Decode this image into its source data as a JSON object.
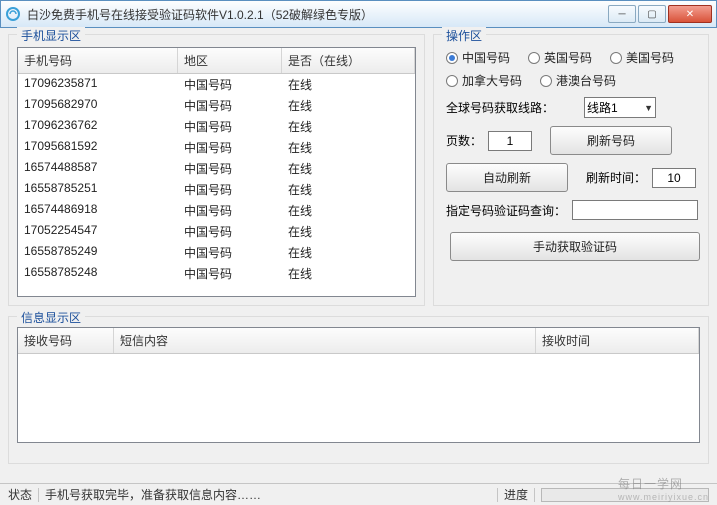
{
  "window": {
    "title": "白沙免费手机号在线接受验证码软件V1.0.2.1（52破解绿色专版）"
  },
  "phone_area": {
    "legend": "手机显示区",
    "columns": {
      "phone": "手机号码",
      "region": "地区",
      "online": "是否（在线）"
    },
    "rows": [
      {
        "phone": "17096235871",
        "region": "中国号码",
        "online": "在线"
      },
      {
        "phone": "17095682970",
        "region": "中国号码",
        "online": "在线"
      },
      {
        "phone": "17096236762",
        "region": "中国号码",
        "online": "在线"
      },
      {
        "phone": "17095681592",
        "region": "中国号码",
        "online": "在线"
      },
      {
        "phone": "16574488587",
        "region": "中国号码",
        "online": "在线"
      },
      {
        "phone": "16558785251",
        "region": "中国号码",
        "online": "在线"
      },
      {
        "phone": "16574486918",
        "region": "中国号码",
        "online": "在线"
      },
      {
        "phone": "17052254547",
        "region": "中国号码",
        "online": "在线"
      },
      {
        "phone": "16558785249",
        "region": "中国号码",
        "online": "在线"
      },
      {
        "phone": "16558785248",
        "region": "中国号码",
        "online": "在线"
      }
    ]
  },
  "ops": {
    "legend": "操作区",
    "radios": {
      "cn": "中国号码",
      "uk": "英国号码",
      "us": "美国号码",
      "ca": "加拿大号码",
      "hk": "港澳台号码"
    },
    "route_label": "全球号码获取线路：",
    "route_value": "线路1",
    "page_label": "页数：",
    "page_value": "1",
    "refresh_btn": "刷新号码",
    "auto_btn": "自动刷新",
    "refresh_time_label": "刷新时间：",
    "refresh_time_value": "10",
    "query_label": "指定号码验证码查询：",
    "query_value": "",
    "manual_btn": "手动获取验证码"
  },
  "info": {
    "legend": "信息显示区",
    "columns": {
      "recv": "接收号码",
      "msg": "短信内容",
      "time": "接收时间"
    }
  },
  "status": {
    "label": "状态",
    "text": "手机号获取完毕，准备获取信息内容……",
    "progress_label": "进度"
  },
  "watermark": {
    "main": "每日一学网",
    "sub": "www.meiriyixue.cn"
  }
}
